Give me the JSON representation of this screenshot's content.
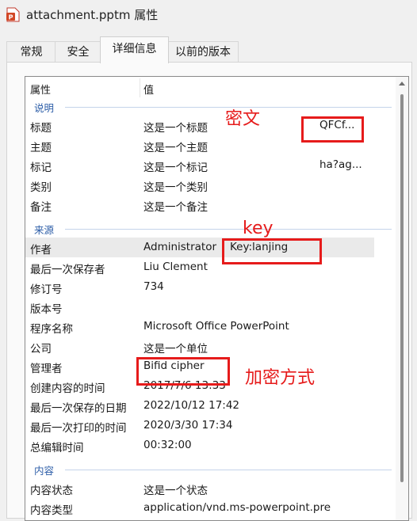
{
  "window": {
    "title": "attachment.pptm 属性"
  },
  "tabs": [
    "常规",
    "安全",
    "详细信息",
    "以前的版本"
  ],
  "active_tab": 2,
  "table": {
    "col_property": "属性",
    "col_value": "值",
    "groups": {
      "description": {
        "label": "说明",
        "rows": [
          {
            "k": "标题",
            "v": "这是一个标题",
            "v2": "QFCf..."
          },
          {
            "k": "主题",
            "v": "这是一个主题"
          },
          {
            "k": "标记",
            "v": "这是一个标记",
            "v2": "ha?ag..."
          },
          {
            "k": "类别",
            "v": "这是一个类别"
          },
          {
            "k": "备注",
            "v": "这是一个备注"
          }
        ]
      },
      "origin": {
        "label": "来源",
        "rows": [
          {
            "k": "作者",
            "v": "Administrator",
            "v2": "Key:lanjing"
          },
          {
            "k": "最后一次保存者",
            "v": "Liu Clement"
          },
          {
            "k": "修订号",
            "v": "734"
          },
          {
            "k": "版本号",
            "v": ""
          },
          {
            "k": "程序名称",
            "v": "Microsoft Office PowerPoint"
          },
          {
            "k": "公司",
            "v": "这是一个单位"
          },
          {
            "k": "管理者",
            "v": "Bifid cipher"
          },
          {
            "k": "创建内容的时间",
            "v": "2017/7/6 13:33"
          },
          {
            "k": "最后一次保存的日期",
            "v": "2022/10/12 17:42"
          },
          {
            "k": "最后一次打印的时间",
            "v": "2020/3/30 17:34"
          },
          {
            "k": "总编辑时间",
            "v": "00:32:00"
          }
        ]
      },
      "content": {
        "label": "内容",
        "rows": [
          {
            "k": "内容状态",
            "v": "这是一个状态"
          },
          {
            "k": "内容类型",
            "v": "application/vnd.ms-powerpoint.pre"
          }
        ]
      }
    }
  },
  "annotations": {
    "ciphertext": "密文",
    "key": "key",
    "encryption_method": "加密方式"
  },
  "colors": {
    "annotation": "#e61b1b",
    "group_label": "#2d5ea8",
    "selected_row": "#eaeaea"
  }
}
